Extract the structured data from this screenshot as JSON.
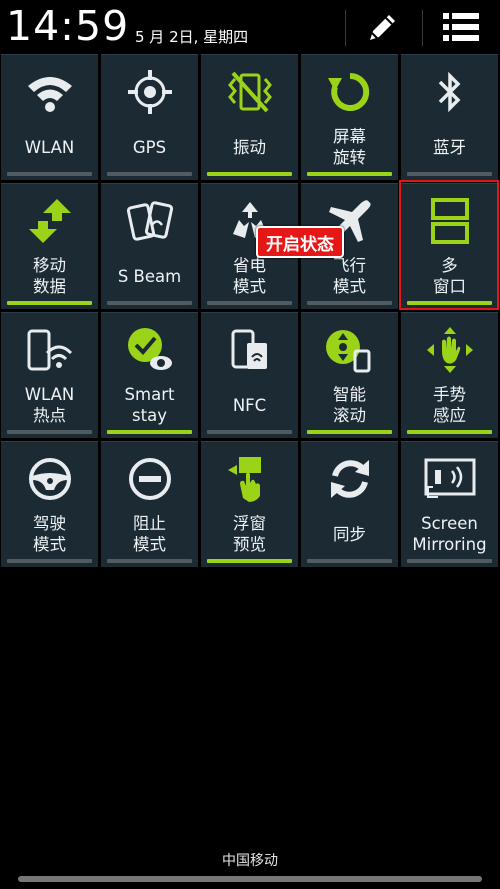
{
  "status_bar": {
    "time": "14:59",
    "date": "5 月 2日, 星期四",
    "edit_icon": "pencil-icon",
    "menu_icon": "list-menu-icon"
  },
  "colors": {
    "active": "#9bd318",
    "inactive": "#525b60",
    "tile_bg": "#1b2a33",
    "highlight": "#e5141a"
  },
  "toggles": [
    {
      "label": [
        "WLAN"
      ],
      "icon": "wifi-icon",
      "active": false
    },
    {
      "label": [
        "GPS"
      ],
      "icon": "gps-icon",
      "active": false
    },
    {
      "label": [
        "振动"
      ],
      "icon": "vibrate-icon",
      "active": true
    },
    {
      "label": [
        "屏幕",
        "旋转"
      ],
      "icon": "rotate-icon",
      "active": true
    },
    {
      "label": [
        "蓝牙"
      ],
      "icon": "bluetooth-icon",
      "active": false
    },
    {
      "label": [
        "移动",
        "数据"
      ],
      "icon": "mobile-data-icon",
      "active": true
    },
    {
      "label": [
        "S Beam"
      ],
      "icon": "s-beam-icon",
      "active": false
    },
    {
      "label": [
        "省电",
        "模式"
      ],
      "icon": "power-saving-icon",
      "active": false
    },
    {
      "label": [
        "飞行",
        "模式"
      ],
      "icon": "airplane-icon",
      "active": false
    },
    {
      "label": [
        "多",
        "窗口"
      ],
      "icon": "multi-window-icon",
      "active": true
    },
    {
      "label": [
        "WLAN",
        "热点"
      ],
      "icon": "wifi-hotspot-icon",
      "active": false
    },
    {
      "label": [
        "Smart",
        "stay"
      ],
      "icon": "smart-stay-icon",
      "active": true
    },
    {
      "label": [
        "NFC"
      ],
      "icon": "nfc-icon",
      "active": false
    },
    {
      "label": [
        "智能",
        "滚动"
      ],
      "icon": "smart-scroll-icon",
      "active": true
    },
    {
      "label": [
        "手势",
        "感应"
      ],
      "icon": "air-gesture-icon",
      "active": true
    },
    {
      "label": [
        "驾驶",
        "模式"
      ],
      "icon": "driving-mode-icon",
      "active": false
    },
    {
      "label": [
        "阻止",
        "模式"
      ],
      "icon": "blocking-mode-icon",
      "active": false
    },
    {
      "label": [
        "浮窗",
        "预览"
      ],
      "icon": "air-view-icon",
      "active": true
    },
    {
      "label": [
        "同步"
      ],
      "icon": "sync-icon",
      "active": false
    },
    {
      "label": [
        "Screen",
        "Mirroring"
      ],
      "icon": "screen-mirroring-icon",
      "active": false
    }
  ],
  "callout": "开启状态",
  "carrier": "中国移动"
}
